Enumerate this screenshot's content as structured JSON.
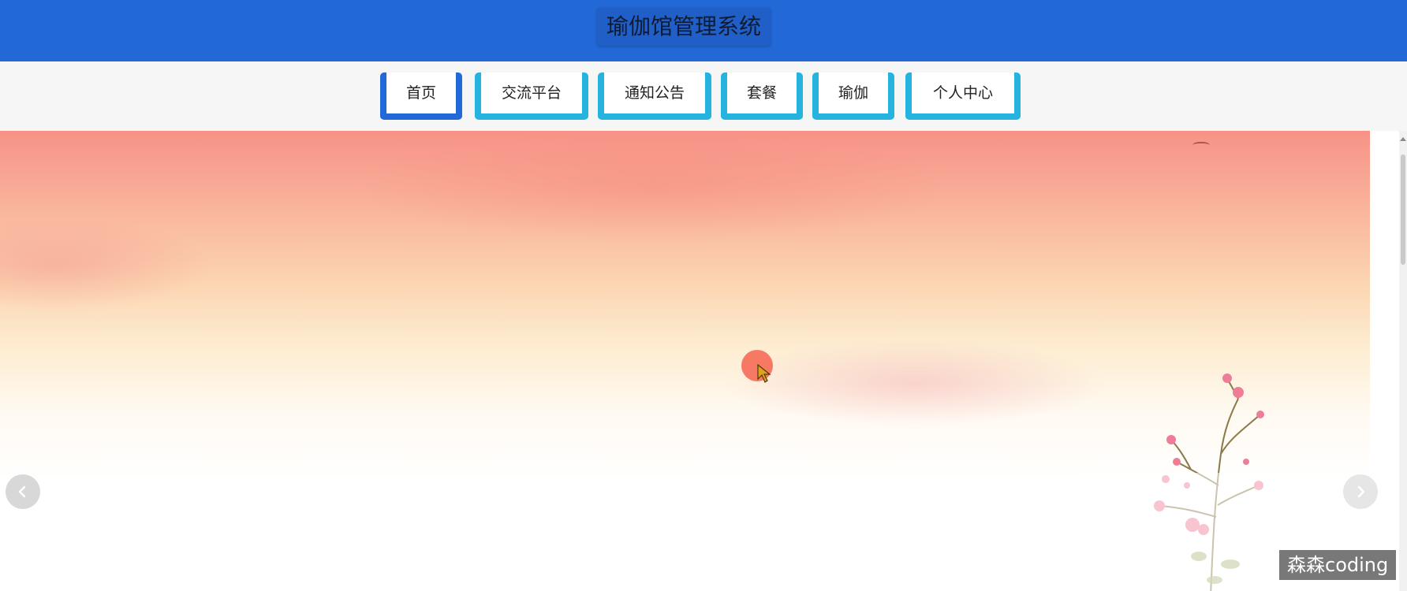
{
  "header": {
    "title": "瑜伽馆管理系统"
  },
  "nav": {
    "items": [
      {
        "label": "首页",
        "active": true
      },
      {
        "label": "交流平台",
        "active": false
      },
      {
        "label": "通知公告",
        "active": false
      },
      {
        "label": "套餐",
        "active": false
      },
      {
        "label": "瑜伽",
        "active": false
      },
      {
        "label": "个人中心",
        "active": false
      }
    ]
  },
  "carousel": {
    "prev_icon": "chevron-left-icon",
    "next_icon": "chevron-right-icon"
  },
  "watermark": {
    "text": "森森coding"
  },
  "colors": {
    "header_bg": "#2268d6",
    "nav_border": "#24b4df",
    "nav_active_border": "#2268d6",
    "nav_strip_bg": "#f6f6f7"
  }
}
